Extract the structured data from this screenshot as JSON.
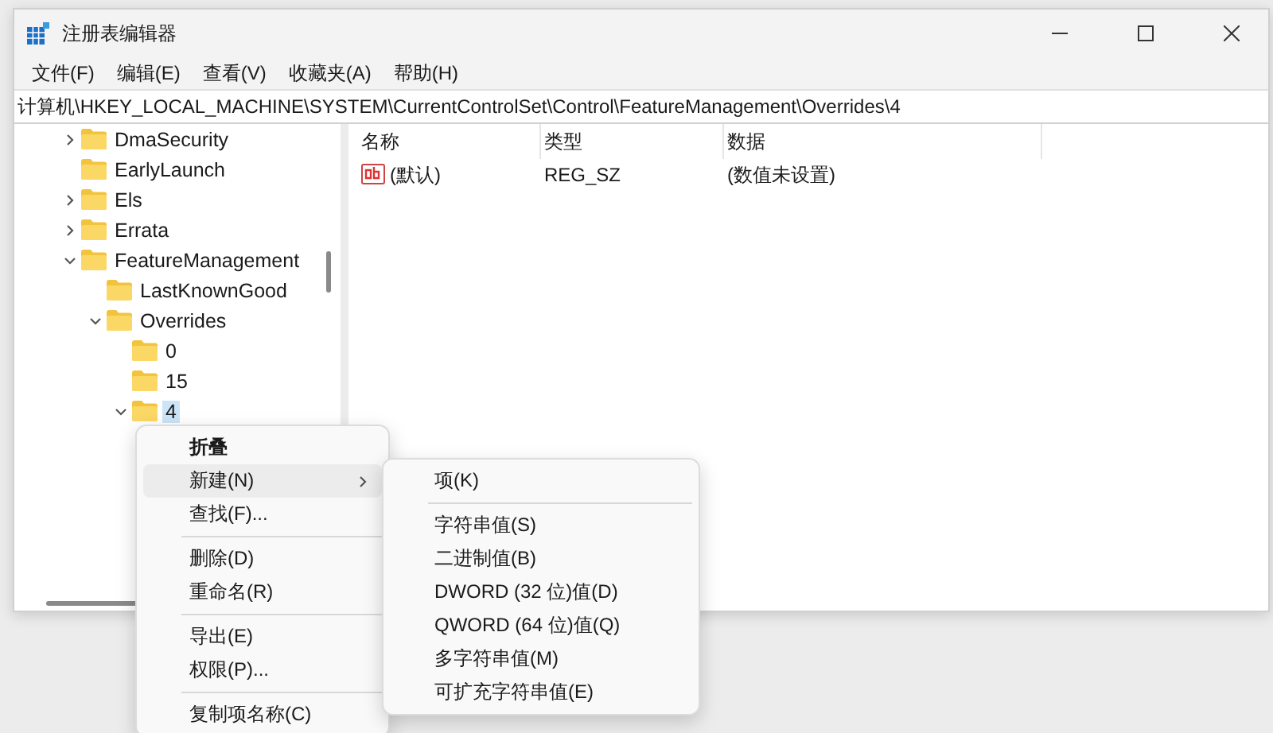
{
  "window": {
    "title": "注册表编辑器"
  },
  "menu": [
    "文件(F)",
    "编辑(E)",
    "查看(V)",
    "收藏夹(A)",
    "帮助(H)"
  ],
  "address": "计算机\\HKEY_LOCAL_MACHINE\\SYSTEM\\CurrentControlSet\\Control\\FeatureManagement\\Overrides\\4",
  "tree": [
    {
      "label": "DmaSecurity",
      "expandable": true,
      "expanded": false,
      "selected": false
    },
    {
      "label": "EarlyLaunch",
      "expandable": false,
      "selected": false
    },
    {
      "label": "Els",
      "expandable": true,
      "expanded": false,
      "selected": false
    },
    {
      "label": "Errata",
      "expandable": true,
      "expanded": false,
      "selected": false
    },
    {
      "label": "FeatureManagement",
      "expandable": true,
      "expanded": true,
      "selected": false,
      "children": [
        {
          "label": "LastKnownGood",
          "expandable": false,
          "selected": false
        },
        {
          "label": "Overrides",
          "expandable": true,
          "expanded": true,
          "selected": false,
          "children": [
            {
              "label": "0",
              "expandable": false,
              "selected": false
            },
            {
              "label": "15",
              "expandable": false,
              "selected": false
            },
            {
              "label": "4",
              "expandable": true,
              "expanded": true,
              "selected": true
            }
          ]
        }
      ]
    }
  ],
  "list": {
    "columns": [
      "名称",
      "类型",
      "数据"
    ],
    "rows": [
      {
        "name": "(默认)",
        "type": "REG_SZ",
        "data": "(数值未设置)"
      }
    ]
  },
  "context_menu": [
    {
      "kind": "item",
      "label": "折叠",
      "default": true,
      "selected": false,
      "has_submenu": false
    },
    {
      "kind": "item",
      "label": "新建(N)",
      "default": false,
      "selected": true,
      "has_submenu": true
    },
    {
      "kind": "item",
      "label": "查找(F)...",
      "default": false,
      "selected": false,
      "has_submenu": false
    },
    {
      "kind": "separator"
    },
    {
      "kind": "item",
      "label": "删除(D)",
      "default": false,
      "selected": false,
      "has_submenu": false
    },
    {
      "kind": "item",
      "label": "重命名(R)",
      "default": false,
      "selected": false,
      "has_submenu": false
    },
    {
      "kind": "separator"
    },
    {
      "kind": "item",
      "label": "导出(E)",
      "default": false,
      "selected": false,
      "has_submenu": false
    },
    {
      "kind": "item",
      "label": "权限(P)...",
      "default": false,
      "selected": false,
      "has_submenu": false
    },
    {
      "kind": "separator"
    },
    {
      "kind": "item",
      "label": "复制项名称(C)",
      "default": false,
      "selected": false,
      "has_submenu": false
    }
  ],
  "submenu": [
    {
      "kind": "item",
      "label": "项(K)"
    },
    {
      "kind": "separator"
    },
    {
      "kind": "item",
      "label": "字符串值(S)"
    },
    {
      "kind": "item",
      "label": "二进制值(B)"
    },
    {
      "kind": "item",
      "label": "DWORD (32 位)值(D)"
    },
    {
      "kind": "item",
      "label": "QWORD (64 位)值(Q)"
    },
    {
      "kind": "item",
      "label": "多字符串值(M)"
    },
    {
      "kind": "item",
      "label": "可扩充字符串值(E)"
    }
  ]
}
